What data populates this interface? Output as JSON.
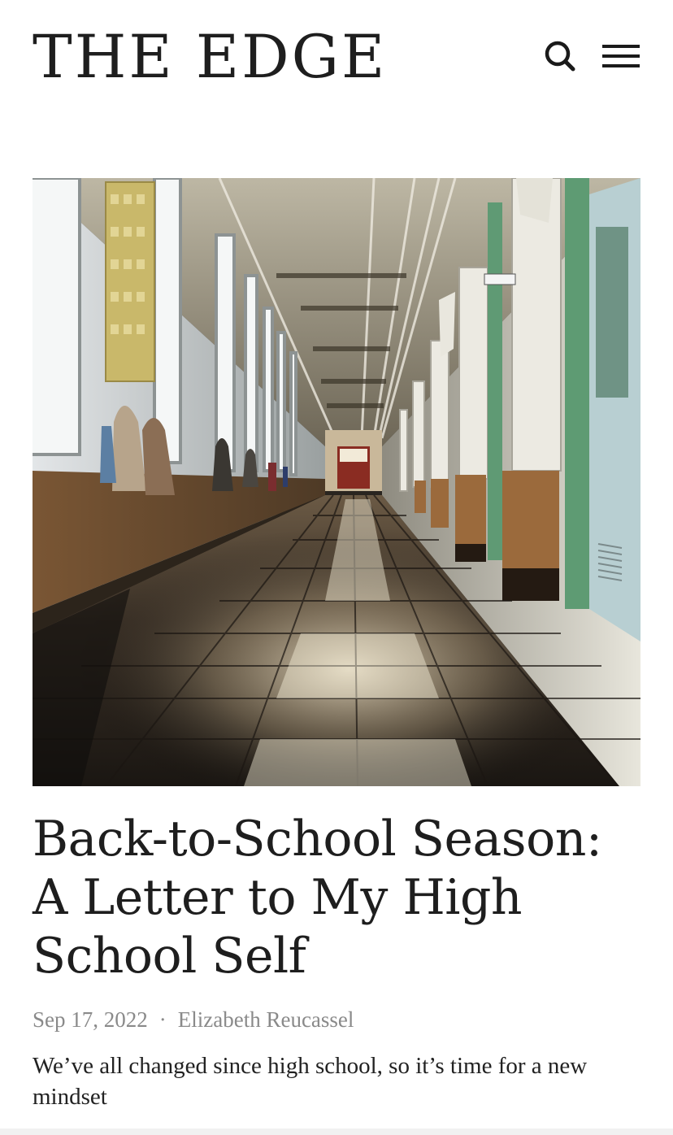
{
  "header": {
    "site_title": "THE EDGE",
    "search_icon": "search-icon",
    "menu_icon": "hamburger-menu-icon"
  },
  "article": {
    "hero_image": "school-hallway-photo",
    "title": "Back-to-School Season: A Letter to My High School Self",
    "date": "Sep 17, 2022",
    "separator": "·",
    "author": "Elizabeth Reucassel",
    "dek": "We’ve all changed since high school, so it’s time for a new mindset"
  },
  "colors": {
    "text": "#1e1e1e",
    "meta": "#8a8a8a",
    "background": "#ffffff"
  }
}
